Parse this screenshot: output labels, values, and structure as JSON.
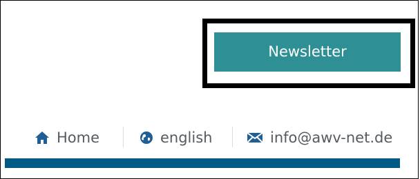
{
  "header": {
    "newsletter_label": "Newsletter"
  },
  "utility_nav": {
    "items": [
      {
        "label": "Home",
        "icon": "home-icon"
      },
      {
        "label": "english",
        "icon": "globe-icon"
      },
      {
        "label": "info@awv-net.de",
        "icon": "envelope-icon"
      }
    ]
  },
  "colors": {
    "accent_teal": "#2e8f94",
    "brand_blue": "#005a86",
    "icon_blue": "#1f5f96",
    "text_gray": "#555b60"
  }
}
